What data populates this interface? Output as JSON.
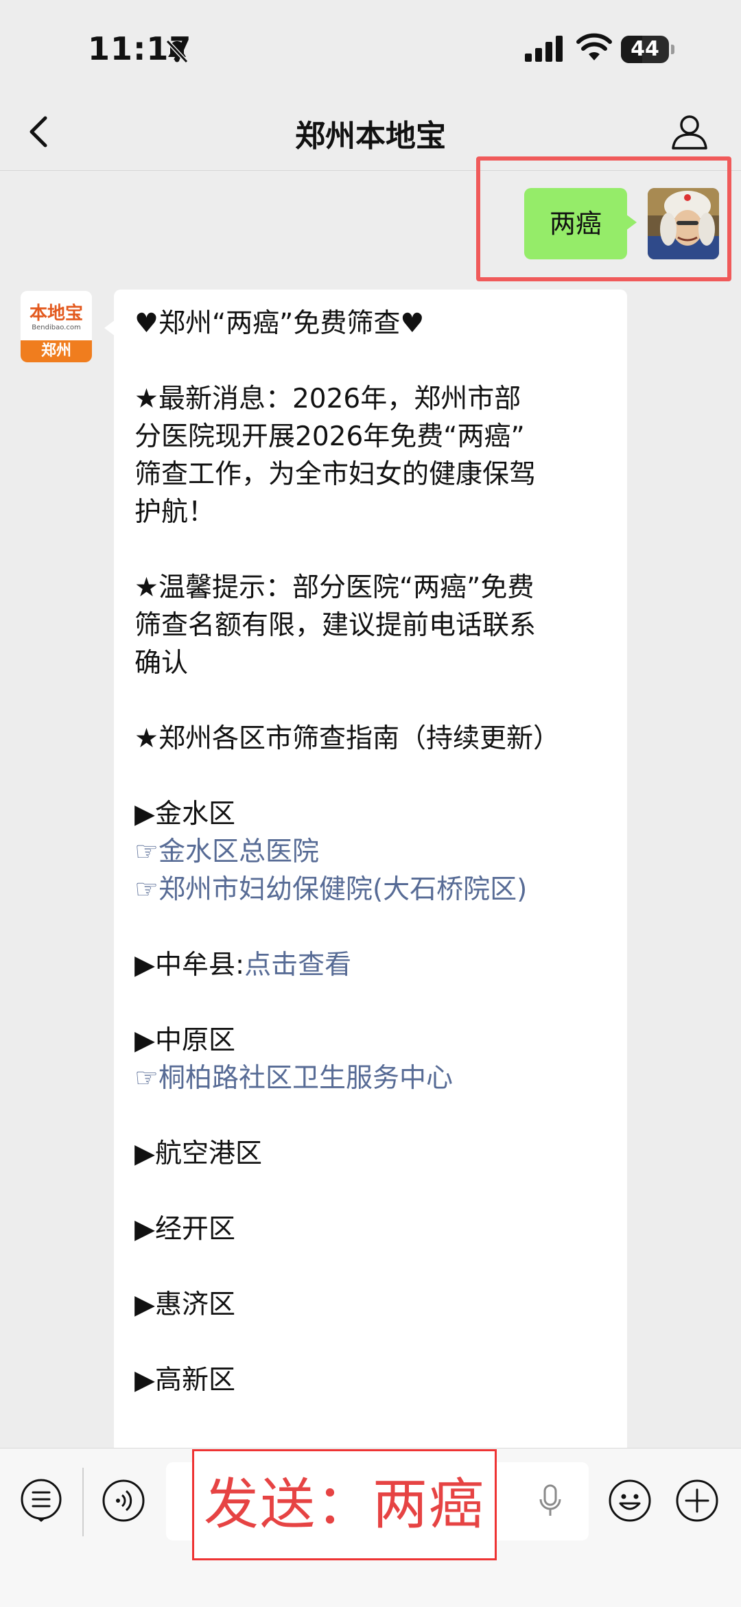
{
  "status_bar": {
    "time": "11:17",
    "battery": "44",
    "battery_level": 0.44
  },
  "nav": {
    "title": "郑州本地宝"
  },
  "sent_message": {
    "text": "两癌"
  },
  "bot": {
    "logo_text": "本地宝",
    "logo_sub": "Bendibao.com",
    "logo_city": "郑州"
  },
  "message": {
    "title": "♥郑州“两癌”免费筛查♥",
    "news": [
      "★最新消息：2026年，郑州市部",
      "分医院现开展2026年免费“两癌”",
      "筛查工作，为全市妇女的健康保驾",
      "护航！"
    ],
    "tip": [
      "★温馨提示：部分医院“两癌”免费",
      "筛查名额有限，建议提前电话联系",
      "确认"
    ],
    "guide_heading": "★郑州各区市筛查指南（持续更新）",
    "jinshui": {
      "heading": "▶金水区",
      "link1_prefix": "☞",
      "link1": "金水区总医院",
      "link2_prefix": "☞",
      "link2": "郑州市妇幼保健院(大石桥院区)"
    },
    "zhongmou": {
      "heading": "▶中牟县:",
      "link": "点击查看"
    },
    "zhongyuan": {
      "heading": "▶中原区",
      "link_prefix": "☞",
      "link": "桐柏路社区卫生服务中心"
    },
    "hangkong": "▶航空港区",
    "jingkai": "▶经开区",
    "huiji": "▶惠济区",
    "gaoxin": "▶高新区"
  },
  "input": {
    "overlay_text": "发送：两癌"
  },
  "icons": [
    "bell-mute-icon",
    "signal-icon",
    "wifi-icon",
    "back-chevron-icon",
    "profile-icon",
    "menu-icon",
    "voice-icon",
    "mic-icon",
    "emoji-icon",
    "plus-icon"
  ]
}
